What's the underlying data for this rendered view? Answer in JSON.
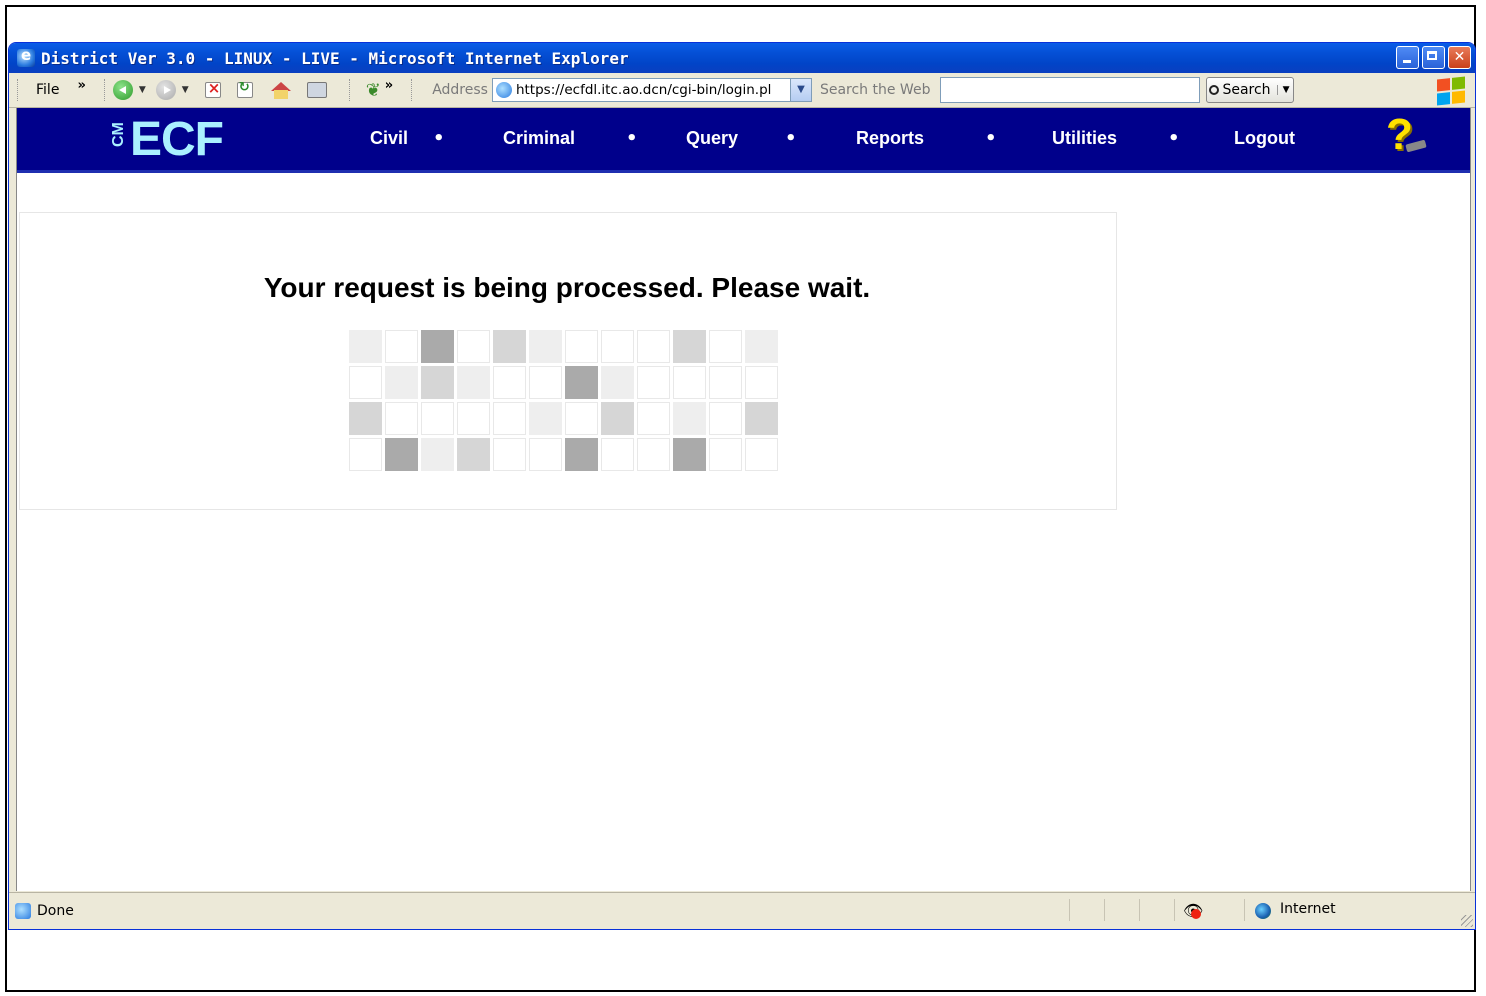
{
  "window": {
    "title": "District Ver 3.0 - LINUX - LIVE - Microsoft Internet Explorer"
  },
  "toolbar": {
    "file_label": "File",
    "address_label": "Address",
    "address_value": "https://ecfdl.itc.ao.dcn/cgi-bin/login.pl",
    "search_web_label": "Search the Web",
    "search_value": "",
    "search_button_label": "Search"
  },
  "ecf": {
    "logo_cm": "CM",
    "logo_text": "ECF",
    "nav": [
      {
        "label": "Civil"
      },
      {
        "label": "Criminal"
      },
      {
        "label": "Query"
      },
      {
        "label": "Reports"
      },
      {
        "label": "Utilities"
      },
      {
        "label": "Logout"
      }
    ]
  },
  "main": {
    "wait_message": "Your request is being processed. Please wait.",
    "progress_grid_levels": [
      [
        1,
        0,
        3,
        0,
        2,
        1,
        0,
        0,
        0,
        2,
        0,
        1
      ],
      [
        0,
        1,
        2,
        1,
        0,
        0,
        3,
        1,
        0,
        0,
        0,
        0
      ],
      [
        2,
        0,
        0,
        0,
        0,
        1,
        0,
        2,
        0,
        1,
        0,
        2
      ],
      [
        0,
        3,
        1,
        2,
        0,
        0,
        3,
        0,
        0,
        3,
        0,
        0
      ]
    ]
  },
  "status": {
    "text": "Done",
    "zone": "Internet"
  }
}
